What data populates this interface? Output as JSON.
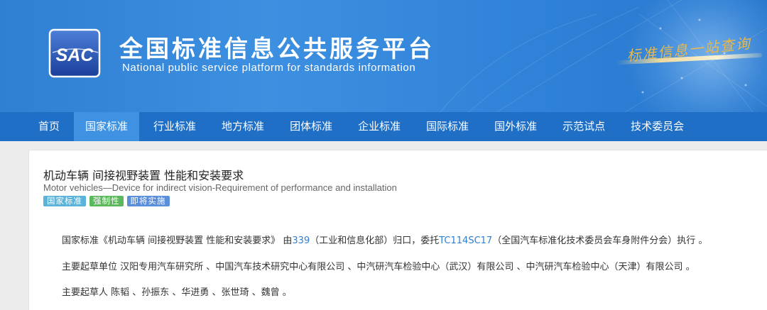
{
  "header": {
    "logo_text": "SAC",
    "title": "全国标准信息公共服务平台",
    "subtitle": "National public service platform  for standards information",
    "slogan": "标准信息一站查询"
  },
  "nav": {
    "items": [
      {
        "label": "首页",
        "active": false
      },
      {
        "label": "国家标准",
        "active": true
      },
      {
        "label": "行业标准",
        "active": false
      },
      {
        "label": "地方标准",
        "active": false
      },
      {
        "label": "团体标准",
        "active": false
      },
      {
        "label": "企业标准",
        "active": false
      },
      {
        "label": "国际标准",
        "active": false
      },
      {
        "label": "国外标准",
        "active": false
      },
      {
        "label": "示范试点",
        "active": false
      },
      {
        "label": "技术委员会",
        "active": false
      }
    ]
  },
  "standard": {
    "title": "机动车辆 间接视野装置 性能和安装要求",
    "title_en": "Motor vehicles—Device for indirect vision-Requirement of performance and installation",
    "badges": [
      {
        "label": "国家标准",
        "color": "#5bb3d9"
      },
      {
        "label": "强制性",
        "color": "#5cb85c"
      },
      {
        "label": "即将实施",
        "color": "#5b8fd9"
      }
    ],
    "desc": {
      "part1": "国家标准《机动车辆 间接视野装置 性能和安装要求》 由",
      "link1": "339",
      "part2": "（工业和信息化部）归口，委托",
      "link2": "TC114SC17",
      "part3": "（全国汽车标准化技术委员会车身附件分会）执行 。"
    },
    "drafting_units": "主要起草单位 汉阳专用汽车研究所 、中国汽车技术研究中心有限公司 、中汽研汽车检验中心（武汉）有限公司 、中汽研汽车检验中心（天津）有限公司 。",
    "drafters": "主要起草人 陈韬 、孙振东 、华进勇 、张世琦 、魏曾 。"
  },
  "colors": {
    "banner": "#2f7fd3",
    "nav": "#1f6fc6",
    "nav_active": "#3f92e2",
    "link": "#2f7fd3"
  }
}
